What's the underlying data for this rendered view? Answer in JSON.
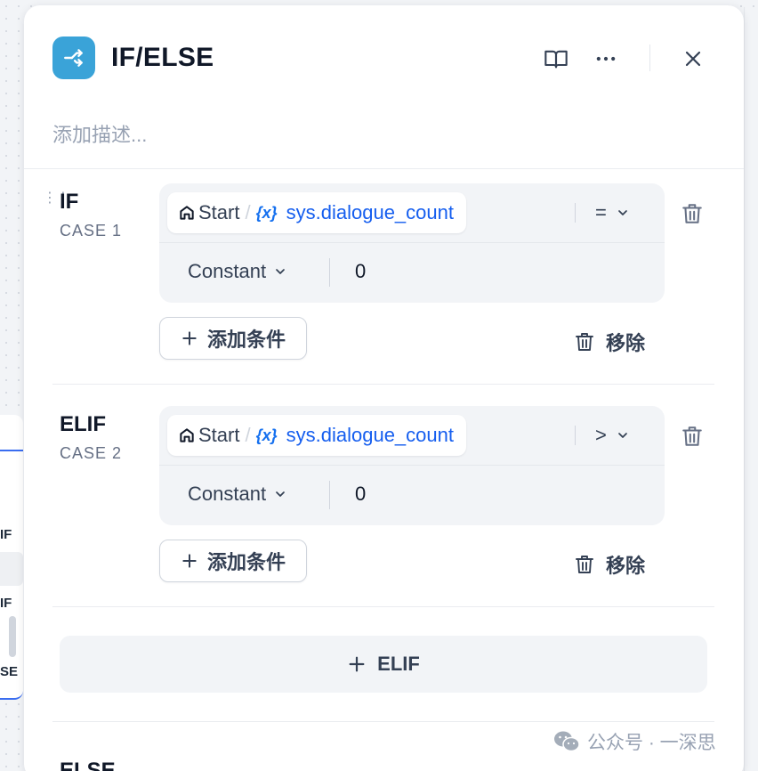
{
  "canvas": {
    "node_labels": [
      "IF",
      "IF",
      "SE"
    ]
  },
  "panel": {
    "title": "IF/ELSE",
    "description_placeholder": "添加描述...",
    "icons": {
      "node_icon": "branch-icon",
      "docs": "book-icon",
      "more": "more-horizontal-icon",
      "close": "close-icon"
    }
  },
  "cases": [
    {
      "label": "IF",
      "sublabel": "CASE 1",
      "condition": {
        "source": "Start",
        "separator": "/",
        "var_icon": "{x}",
        "variable": "sys.dialogue_count",
        "operator": "=",
        "value_type": "Constant",
        "value": "0"
      },
      "add_condition_label": "添加条件",
      "remove_label": "移除"
    },
    {
      "label": "ELIF",
      "sublabel": "CASE 2",
      "condition": {
        "source": "Start",
        "separator": "/",
        "var_icon": "{x}",
        "variable": "sys.dialogue_count",
        "operator": ">",
        "value_type": "Constant",
        "value": "0"
      },
      "add_condition_label": "添加条件",
      "remove_label": "移除"
    }
  ],
  "add_elif_label": "ELIF",
  "else_label": "ELSE",
  "watermark": "公众号 · 一深思",
  "colors": {
    "accent": "#3aa3d8",
    "variable": "#155eef"
  }
}
